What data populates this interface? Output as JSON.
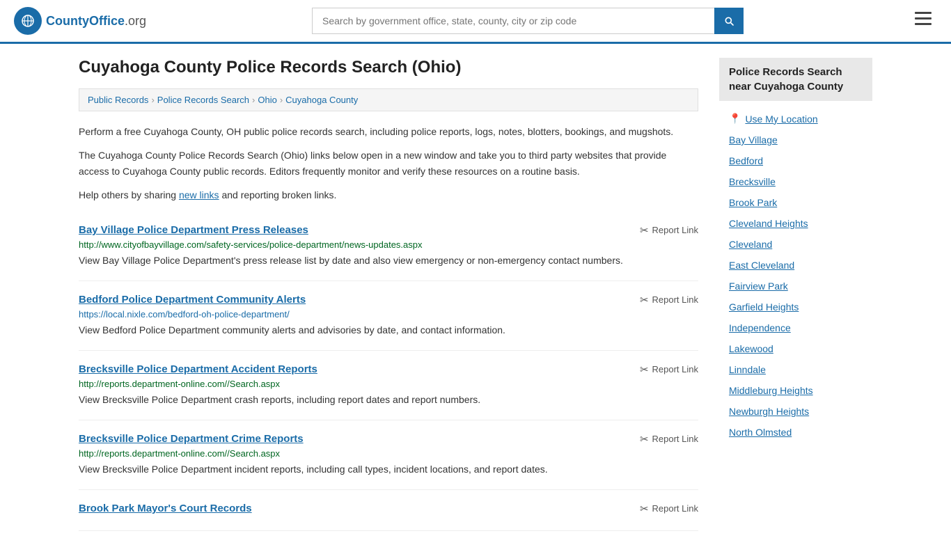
{
  "header": {
    "logo_text": "CountyOffice",
    "logo_suffix": ".org",
    "search_placeholder": "Search by government office, state, county, city or zip code"
  },
  "page": {
    "title": "Cuyahoga County Police Records Search (Ohio)",
    "breadcrumb": [
      {
        "label": "Public Records",
        "href": "#"
      },
      {
        "label": "Police Records Search",
        "href": "#"
      },
      {
        "label": "Ohio",
        "href": "#"
      },
      {
        "label": "Cuyahoga County",
        "href": "#"
      }
    ],
    "description1": "Perform a free Cuyahoga County, OH public police records search, including police reports, logs, notes, blotters, bookings, and mugshots.",
    "description2": "The Cuyahoga County Police Records Search (Ohio) links below open in a new window and take you to third party websites that provide access to Cuyahoga County public records. Editors frequently monitor and verify these resources on a routine basis.",
    "description3_prefix": "Help others by sharing ",
    "description3_link": "new links",
    "description3_suffix": " and reporting broken links."
  },
  "results": [
    {
      "title": "Bay Village Police Department Press Releases",
      "url": "http://www.cityofbayvillage.com/safety-services/police-department/news-updates.aspx",
      "url_color": "green",
      "description": "View Bay Village Police Department's press release list by date and also view emergency or non-emergency contact numbers.",
      "report_label": "Report Link"
    },
    {
      "title": "Bedford Police Department Community Alerts",
      "url": "https://local.nixle.com/bedford-oh-police-department/",
      "url_color": "blue",
      "description": "View Bedford Police Department community alerts and advisories by date, and contact information.",
      "report_label": "Report Link"
    },
    {
      "title": "Brecksville Police Department Accident Reports",
      "url": "http://reports.department-online.com//Search.aspx",
      "url_color": "green",
      "description": "View Brecksville Police Department crash reports, including report dates and report numbers.",
      "report_label": "Report Link"
    },
    {
      "title": "Brecksville Police Department Crime Reports",
      "url": "http://reports.department-online.com//Search.aspx",
      "url_color": "green",
      "description": "View Brecksville Police Department incident reports, including call types, incident locations, and report dates.",
      "report_label": "Report Link"
    },
    {
      "title": "Brook Park Mayor's Court Records",
      "url": "",
      "url_color": "green",
      "description": "",
      "report_label": "Report Link"
    }
  ],
  "sidebar": {
    "title": "Police Records Search near Cuyahoga County",
    "use_my_location": "Use My Location",
    "items": [
      "Bay Village",
      "Bedford",
      "Brecksville",
      "Brook Park",
      "Cleveland Heights",
      "Cleveland",
      "East Cleveland",
      "Fairview Park",
      "Garfield Heights",
      "Independence",
      "Lakewood",
      "Linndale",
      "Middleburg Heights",
      "Newburgh Heights",
      "North Olmsted"
    ]
  }
}
